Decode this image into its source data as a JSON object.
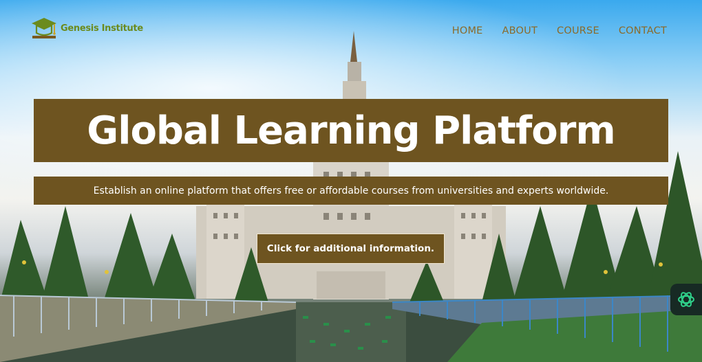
{
  "brand": {
    "name": "Genesis Institute",
    "logo_icon": "graduation-cap-icon",
    "color": "#6b8b1e"
  },
  "nav": {
    "items": [
      {
        "label": "HOME"
      },
      {
        "label": "ABOUT"
      },
      {
        "label": "COURSE"
      },
      {
        "label": "CONTACT"
      }
    ]
  },
  "hero": {
    "title": "Global Learning Platform",
    "subtitle": "Establish an online platform that offers free or affordable courses from universities and experts worldwide.",
    "cta_label": "Click for additional information."
  },
  "colors": {
    "accent": "#6e5420",
    "nav_text": "#8a6a2a",
    "widget_bg": "#172a24",
    "widget_icon": "#2fd08a"
  },
  "widget": {
    "icon": "openai-logo-icon"
  }
}
